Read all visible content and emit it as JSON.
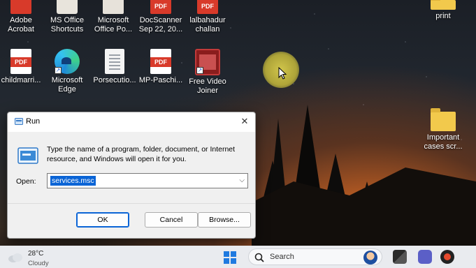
{
  "desktop": {
    "icons": [
      {
        "id": "adobe-acrobat",
        "label": "Adobe\nAcrobat"
      },
      {
        "id": "ms-office-shortcuts",
        "label": "MS Office\nShortcuts"
      },
      {
        "id": "microsoft-office-po",
        "label": "Microsoft\nOffice Po..."
      },
      {
        "id": "docscanner",
        "label": "DocScanner\nSep 22, 20..."
      },
      {
        "id": "lalbahadur-challan",
        "label": "lalbahadur\nchallan"
      },
      {
        "id": "print",
        "label": "print"
      },
      {
        "id": "childmarri",
        "label": "childmarri..."
      },
      {
        "id": "microsoft-edge",
        "label": "Microsoft\nEdge"
      },
      {
        "id": "porsecutio",
        "label": "Porsecutio..."
      },
      {
        "id": "mp-paschi",
        "label": "MP-Paschi..."
      },
      {
        "id": "free-video-joiner",
        "label": "Free Video\nJoiner"
      },
      {
        "id": "important-cases",
        "label": "Important\ncases scr..."
      }
    ],
    "pdf_badge": "PDF"
  },
  "run_dialog": {
    "title": "Run",
    "description": "Type the name of a program, folder, document, or Internet resource, and Windows will open it for you.",
    "open_label": "Open:",
    "open_value": "services.msc",
    "buttons": {
      "ok": "OK",
      "cancel": "Cancel",
      "browse": "Browse..."
    }
  },
  "taskbar": {
    "weather": {
      "temp": "28°C",
      "condition": "Cloudy"
    },
    "search": {
      "placeholder": "Search"
    }
  }
}
